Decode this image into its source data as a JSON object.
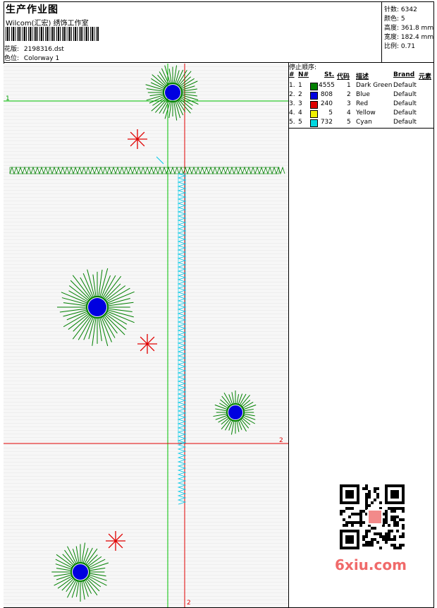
{
  "header": {
    "title": "生产作业图",
    "company": "Wilcom(汇宏) 绣饰工作室",
    "design_label": "花版:",
    "design_value": "2198316.dst",
    "colorway_label": "色位:",
    "colorway_value": "Colorway 1"
  },
  "stats": [
    {
      "label": "针数:",
      "value": "6342"
    },
    {
      "label": "颜色:",
      "value": "5"
    },
    {
      "label": "高度:",
      "value": "361.8 mm"
    },
    {
      "label": "宽度:",
      "value": "182.4 mm"
    },
    {
      "label": "比例:",
      "value": "0.71"
    }
  ],
  "stop_sequence": {
    "title": "停止顺序:",
    "headers": [
      "#",
      "N#",
      "St.",
      "代码",
      "描述",
      "Brand",
      "元素"
    ],
    "rows": [
      {
        "num": "1.",
        "n": "1",
        "color": "#008000",
        "stitches": "4555",
        "code": "1",
        "desc": "Dark Green",
        "brand": "Default"
      },
      {
        "num": "2.",
        "n": "2",
        "color": "#0000e0",
        "stitches": "808",
        "code": "2",
        "desc": "Blue",
        "brand": "Default"
      },
      {
        "num": "3.",
        "n": "3",
        "color": "#e00000",
        "stitches": "240",
        "code": "3",
        "desc": "Red",
        "brand": "Default"
      },
      {
        "num": "4.",
        "n": "4",
        "color": "#f0f000",
        "stitches": "5",
        "code": "4",
        "desc": "Yellow",
        "brand": "Default"
      },
      {
        "num": "5.",
        "n": "5",
        "color": "#00d8e0",
        "stitches": "732",
        "code": "5",
        "desc": "Cyan",
        "brand": "Default"
      }
    ]
  },
  "guides": {
    "h1_label": "1",
    "h2_label": "2",
    "v2_label": "2"
  },
  "watermark": "6xiu.com",
  "colors": {
    "green": "#008000",
    "guide_green": "#00c000",
    "guide_red": "#e00000",
    "blue": "#0000e0",
    "cyan": "#00c8e8",
    "red_mark": "#e00000"
  },
  "icons": [
    "barcode",
    "qr-code"
  ]
}
